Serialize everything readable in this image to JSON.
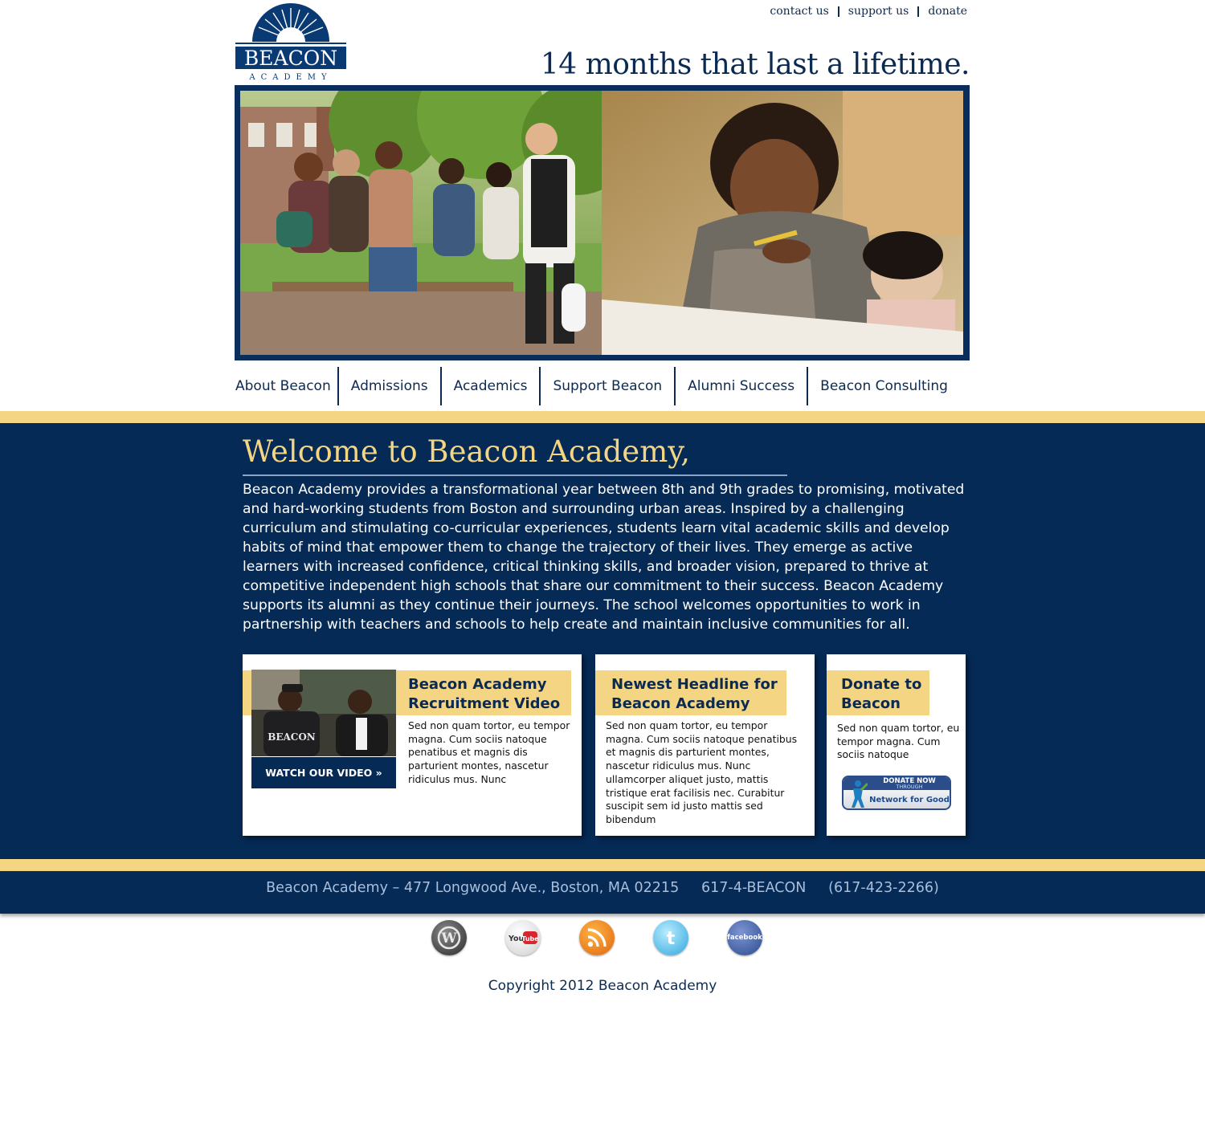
{
  "header": {
    "logo_main": "BEACON",
    "logo_sub": "ACADEMY",
    "top_links": [
      "contact us",
      "support us",
      "donate"
    ],
    "tagline": "14 months that last a lifetime."
  },
  "nav": {
    "items": [
      "About Beacon",
      "Admissions",
      "Academics",
      "Support Beacon",
      "Alumni Success",
      "Beacon Consulting"
    ]
  },
  "main": {
    "welcome_title": "Welcome to Beacon Academy,",
    "intro": "Beacon Academy provides a transformational year between 8th and 9th grades to promising, motivated and hard-working students from Boston and surrounding urban areas. Inspired by a challenging curriculum and stimulating co-curricular experiences, students learn vital academic skills and develop habits of mind that empower them to change the trajectory of their lives. They emerge as active learners with increased confidence, critical thinking skills, and broader vision, prepared to thrive at competitive independent high schools that share our commitment to their success. Beacon Academy supports its alumni as they continue their journeys. The school welcomes opportunities to work in partnership with teachers and schools to help create and maintain inclusive communities for all."
  },
  "cards": {
    "video": {
      "title_line1": "Beacon Academy",
      "title_line2": "Recruitment Video",
      "body": "Sed non quam tortor, eu tempor magna. Cum sociis natoque penatibus et magnis dis parturient montes, nascetur ridiculus mus. Nunc",
      "button": "WATCH OUR VIDEO »",
      "thumb_shirt_text": "BEACON"
    },
    "news": {
      "title_line1": "Newest Headline for",
      "title_line2": "Beacon Academy",
      "body": "Sed non quam tortor, eu tempor magna. Cum sociis natoque penatibus et magnis dis parturient montes, nascetur ridiculus mus. Nunc ullamcorper aliquet justo, mattis tristique erat facilisis nec. Curabitur suscipit sem id justo mattis sed bibendum"
    },
    "donate": {
      "title_line1": "Donate to",
      "title_line2": "Beacon",
      "body": "Sed non quam tortor, eu tempor magna. Cum sociis natoque",
      "badge_line1": "DONATE NOW",
      "badge_line2": "THROUGH",
      "badge_line3": "Network for Good"
    }
  },
  "footer": {
    "address": "Beacon Academy – 477 Longwood Ave., Boston, MA 02215     617-4-BEACON     (617-423-2266)",
    "social": [
      "wordpress-icon",
      "youtube-icon",
      "rss-icon",
      "twitter-icon",
      "facebook-icon"
    ],
    "youtube_label": "You Tube",
    "facebook_label": "facebook",
    "copyright": "Copyright 2012 Beacon Academy"
  },
  "colors": {
    "navy": "#052a56",
    "gold": "#f3d584",
    "text_navy": "#0b2a52",
    "footer_text": "#a9bfdc"
  }
}
